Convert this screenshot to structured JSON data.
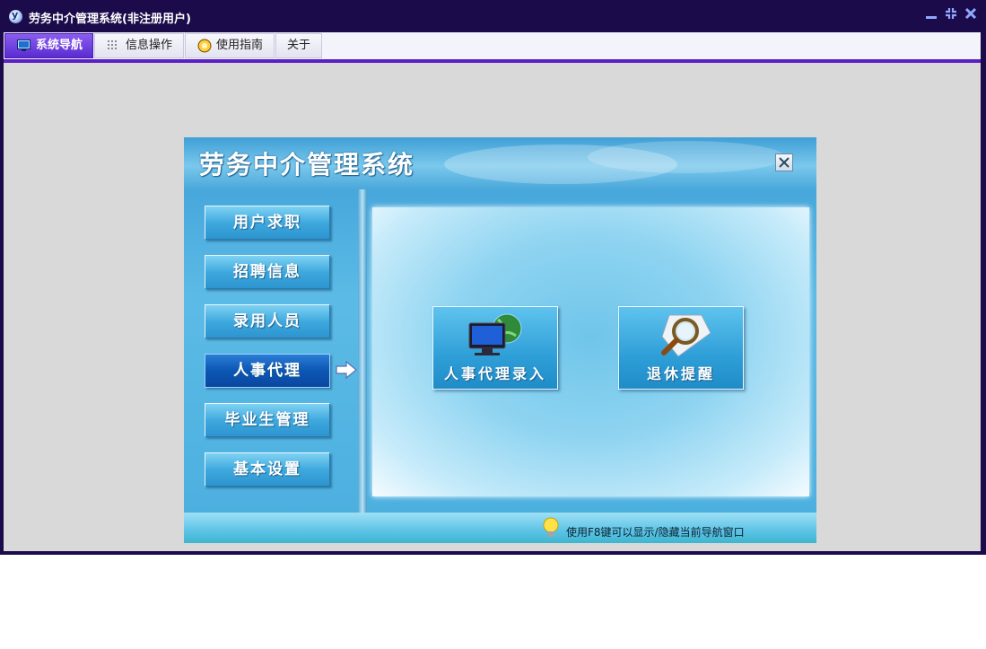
{
  "window": {
    "title": "劳务中介管理系统(非注册用户)",
    "controls": {
      "minimize": "▁",
      "restore": "⇲",
      "close": "✕"
    }
  },
  "tabs": [
    {
      "label": "系统导航",
      "icon": "monitor-icon",
      "active": true
    },
    {
      "label": "信息操作",
      "icon": "grid-icon",
      "active": false
    },
    {
      "label": "使用指南",
      "icon": "compass-icon",
      "active": false
    },
    {
      "label": "关于",
      "icon": "",
      "active": false
    }
  ],
  "panel": {
    "title": "劳务中介管理系统",
    "close_label": "✕",
    "nav_items": [
      {
        "label": "用户求职",
        "active": false
      },
      {
        "label": "招聘信息",
        "active": false
      },
      {
        "label": "录用人员",
        "active": false
      },
      {
        "label": "人事代理",
        "active": true
      },
      {
        "label": "毕业生管理",
        "active": false
      },
      {
        "label": "基本设置",
        "active": false
      }
    ],
    "actions": [
      {
        "label": "人事代理录入",
        "icon": "computer-globe-icon"
      },
      {
        "label": "退休提醒",
        "icon": "magnifier-document-icon"
      }
    ],
    "hint": "使用F8键可以显示/隐藏当前导航窗口"
  },
  "colors": {
    "titlebar": "#1b0b4a",
    "tab_active": "#6a3be0",
    "tab_underline": "#5b1fc4",
    "panel_blue": "#3fa9de",
    "nav_active": "#0c56b4"
  }
}
